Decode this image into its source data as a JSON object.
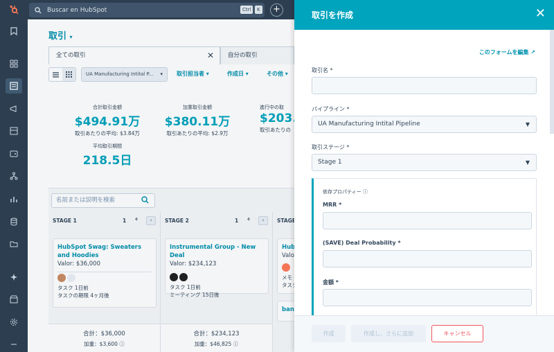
{
  "topbar": {
    "search_placeholder": "Buscar en HubSpot",
    "shortcut_ctrl": "Ctrl",
    "shortcut_k": "K",
    "plus_label": "+"
  },
  "main": {
    "title": "取引",
    "tabs": [
      {
        "label": "全ての取引"
      },
      {
        "label": "自分の取引"
      }
    ],
    "pipeline_select": "UA Manufacturing Intital P...",
    "filters": [
      "取引担当者",
      "作成日",
      "その他"
    ],
    "metrics": [
      {
        "label": "合計取引金額",
        "value": "$494.91万",
        "sub": "取引あたりの平均: $3.84万"
      },
      {
        "label": "加重取引金額",
        "value": "$380.11万",
        "sub": "取引あたりの平均: $2.9万"
      },
      {
        "label": "進行中の取",
        "value": "$203.",
        "sub": "取引あたりの"
      },
      {
        "label": "平均取引期間",
        "value": "218.5日",
        "sub": ""
      }
    ],
    "board_search_placeholder": "名前または説明を検索",
    "columns": [
      {
        "name": "STAGE 1",
        "count": "1",
        "card": {
          "title": "HubSpot Swag: Sweaters and Hoodies",
          "value": "Valor: $36,000",
          "line1": "タスク 1日前",
          "line2": "タスクの期限 4ヶ月後"
        },
        "total": "合計：$36,000",
        "weighted": "加重：$3,600"
      },
      {
        "name": "STAGE 2",
        "count": "1",
        "card": {
          "title": "Instrumental Group - New Deal",
          "value": "Valor: $234,123",
          "line1": "タスク 1日前",
          "line2": "ミーティング 15日後"
        },
        "total": "合計：$234,123",
        "weighted": "加重：$46,825"
      },
      {
        "name": "STAGE",
        "count": "",
        "card": {
          "title": "Hub",
          "value": "Valor",
          "line1": "メモ",
          "line2": "タスク"
        },
        "card2_title": "band",
        "total": "",
        "weighted": ""
      }
    ]
  },
  "panel": {
    "title": "取引を作成",
    "edit_link": "このフォームを編集",
    "fields": {
      "deal_name": "取引名 *",
      "pipeline": "パイプライン *",
      "pipeline_value": "UA Manufacturing Intital Pipeline",
      "stage": "取引ステージ *",
      "stage_value": "Stage 1"
    },
    "dependent": {
      "title": "依存プロパティー",
      "mrr": "MRR *",
      "probability": "(SAVE) Deal Probability *",
      "amount": "金額 *"
    },
    "buttons": {
      "create": "作成",
      "create_more": "作成し、さらに追加",
      "cancel": "キャンセル"
    }
  },
  "colors": {
    "accent": "#00a4bd",
    "sidebar": "#2d3e50",
    "link": "#0091ae",
    "danger": "#f2545b"
  }
}
